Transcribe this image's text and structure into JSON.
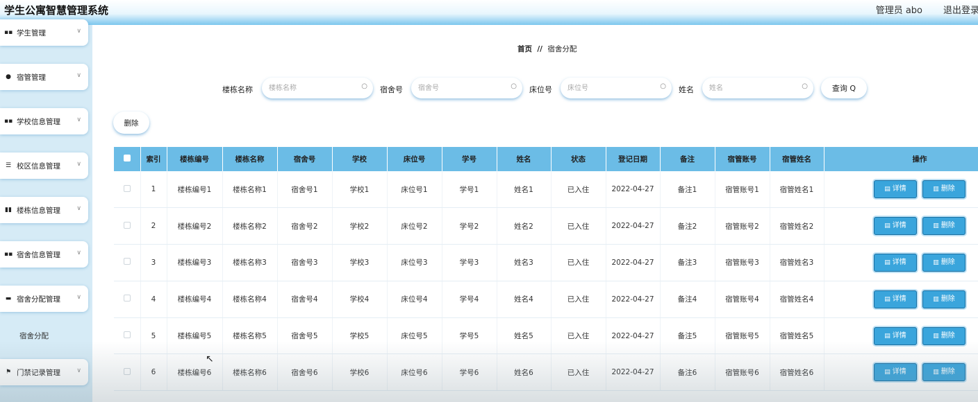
{
  "app": {
    "title": "学生公寓智慧管理系统",
    "user": "管理员 abo",
    "logout": "退出登录"
  },
  "sidebar": {
    "items": [
      {
        "label": "学生管理",
        "icon": "grid-icon"
      },
      {
        "label": "宿管管理",
        "icon": "person-icon"
      },
      {
        "label": "学校信息管理",
        "icon": "grid-icon"
      },
      {
        "label": "校区信息管理",
        "icon": "sliders-icon"
      },
      {
        "label": "楼栋信息管理",
        "icon": "bar-chart-icon"
      },
      {
        "label": "宿舍信息管理",
        "icon": "grid-icon"
      },
      {
        "label": "宿舍分配管理",
        "icon": "chat-icon"
      },
      {
        "label": "门禁记录管理",
        "icon": "flag-icon"
      }
    ],
    "sub_item": "宿舍分配"
  },
  "breadcrumb": {
    "home": "首页",
    "sep": "//",
    "current": "宿舍分配"
  },
  "search": {
    "fields": [
      {
        "label": "楼栋名称",
        "placeholder": "楼栋名称"
      },
      {
        "label": "宿舍号",
        "placeholder": "宿舍号"
      },
      {
        "label": "床位号",
        "placeholder": "床位号"
      },
      {
        "label": "姓名",
        "placeholder": "姓名"
      }
    ],
    "query": "查询 Q"
  },
  "toolbar": {
    "delete": "删除"
  },
  "table": {
    "headers": [
      "索引",
      "楼栋编号",
      "楼栋名称",
      "宿舍号",
      "学校",
      "床位号",
      "学号",
      "姓名",
      "状态",
      "登记日期",
      "备注",
      "宿管账号",
      "宿管姓名",
      "操作"
    ],
    "rows": [
      [
        "1",
        "楼栋编号1",
        "楼栋名称1",
        "宿舍号1",
        "学校1",
        "床位号1",
        "学号1",
        "姓名1",
        "已入住",
        "2022-04-27",
        "备注1",
        "宿管账号1",
        "宿管姓名1"
      ],
      [
        "2",
        "楼栋编号2",
        "楼栋名称2",
        "宿舍号2",
        "学校2",
        "床位号2",
        "学号2",
        "姓名2",
        "已入住",
        "2022-04-27",
        "备注2",
        "宿管账号2",
        "宿管姓名2"
      ],
      [
        "3",
        "楼栋编号3",
        "楼栋名称3",
        "宿舍号3",
        "学校3",
        "床位号3",
        "学号3",
        "姓名3",
        "已入住",
        "2022-04-27",
        "备注3",
        "宿管账号3",
        "宿管姓名3"
      ],
      [
        "4",
        "楼栋编号4",
        "楼栋名称4",
        "宿舍号4",
        "学校4",
        "床位号4",
        "学号4",
        "姓名4",
        "已入住",
        "2022-04-27",
        "备注4",
        "宿管账号4",
        "宿管姓名4"
      ],
      [
        "5",
        "楼栋编号5",
        "楼栋名称5",
        "宿舍号5",
        "学校5",
        "床位号5",
        "学号5",
        "姓名5",
        "已入住",
        "2022-04-27",
        "备注5",
        "宿管账号5",
        "宿管姓名5"
      ],
      [
        "6",
        "楼栋编号6",
        "楼栋名称6",
        "宿舍号6",
        "学校6",
        "床位号6",
        "学号6",
        "姓名6",
        "已入住",
        "2022-04-27",
        "备注6",
        "宿管账号6",
        "宿管姓名6"
      ]
    ],
    "actions": {
      "detail": "详情",
      "delete": "删除"
    }
  },
  "colors": {
    "header_bg": "#6bbce6",
    "button_bg": "#3aa5dc",
    "accent": "#7cc6ee"
  }
}
